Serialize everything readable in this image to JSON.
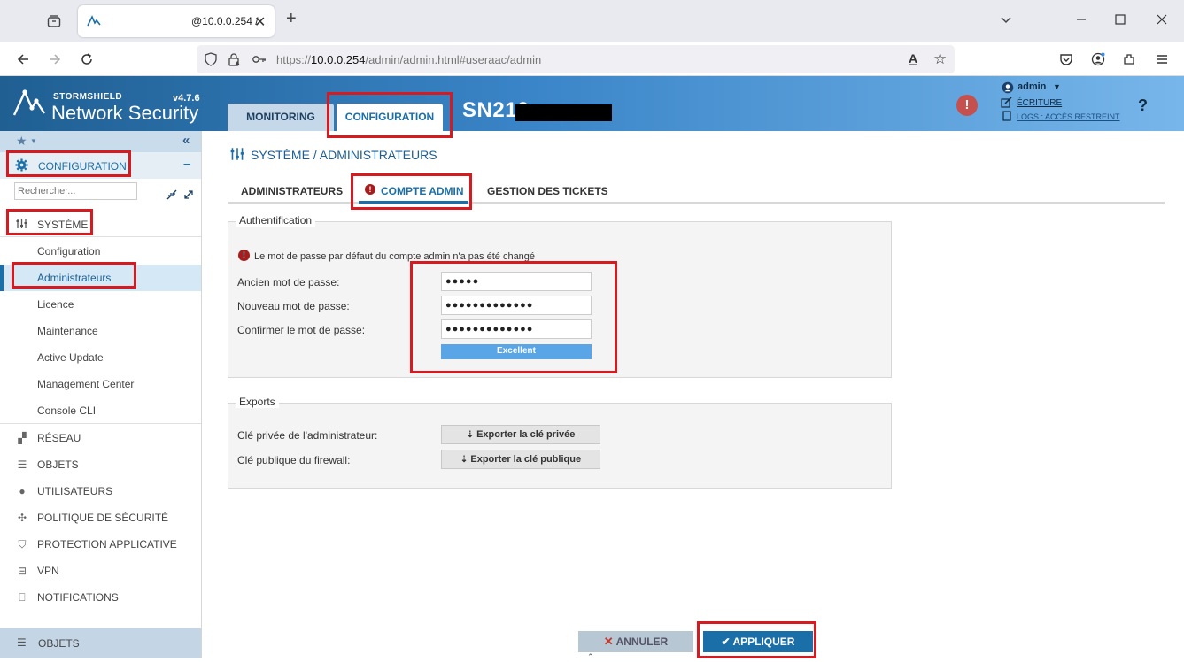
{
  "browser": {
    "tab_title": "@10.0.0.254 /",
    "url_prefix": "https://",
    "url_host": "10.0.0.254",
    "url_path": "/admin/admin.html#useraac/admin"
  },
  "header": {
    "brand_top": "STORMSHIELD",
    "brand_main": "Network Security",
    "version": "v4.7.6",
    "tabs": [
      "MONITORING",
      "CONFIGURATION"
    ],
    "device": "SN210",
    "user": "admin",
    "mode": "ÉCRITURE",
    "logs": "LOGS : ACCÈS RESTREINT",
    "help": "?"
  },
  "sidebar": {
    "section_title": "CONFIGURATION",
    "collapse_symbol": "–",
    "search_placeholder": "Rechercher...",
    "system_title": "SYSTÈME",
    "system_items": [
      "Configuration",
      "Administrateurs",
      "Licence",
      "Maintenance",
      "Active Update",
      "Management Center",
      "Console CLI"
    ],
    "main_items": [
      "RÉSEAU",
      "OBJETS",
      "UTILISATEURS",
      "POLITIQUE DE SÉCURITÉ",
      "PROTECTION APPLICATIVE",
      "VPN",
      "NOTIFICATIONS"
    ],
    "footer_item": "OBJETS"
  },
  "content": {
    "breadcrumb": "SYSTÈME / ADMINISTRATEURS",
    "tabs": [
      "ADMINISTRATEURS",
      "COMPTE ADMIN",
      "GESTION DES TICKETS"
    ],
    "auth_title": "Authentification",
    "warning": "Le mot de passe par défaut du compte admin n'a pas été changé",
    "old_pwd_label": "Ancien mot de passe:",
    "old_pwd_value": "●●●●●",
    "new_pwd_label": "Nouveau mot de passe:",
    "new_pwd_value": "●●●●●●●●●●●●●",
    "confirm_pwd_label": "Confirmer le mot de passe:",
    "confirm_pwd_value": "●●●●●●●●●●●●●",
    "strength": "Excellent",
    "strength_level": 1.0,
    "exports_title": "Exports",
    "private_key_label": "Clé privée de l'administrateur:",
    "private_key_button": "Exporter la clé privée",
    "public_key_label": "Clé publique du firewall:",
    "public_key_button": "Exporter la clé publique",
    "cancel": "ANNULER",
    "apply": "APPLIQUER"
  },
  "colors": {
    "accent": "#1b6fa8",
    "highlight_red": "#d71920",
    "strength_bar": "#5aa5e6",
    "apply_bg": "#1b6fa8",
    "cancel_bg": "#b8c7d4"
  }
}
